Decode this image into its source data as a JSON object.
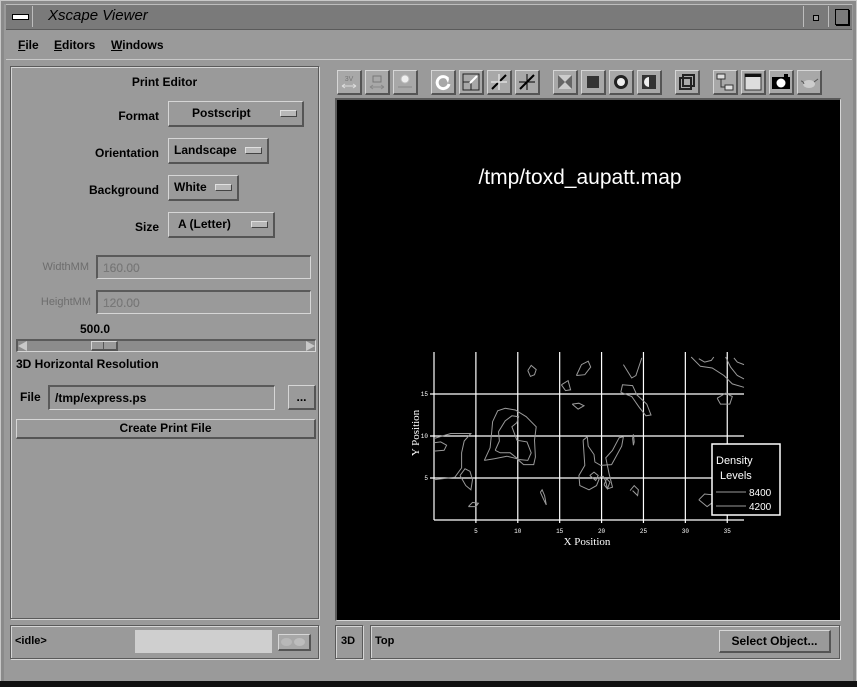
{
  "window": {
    "title": "Xscape Viewer",
    "menu_icon": "window-menu-icon",
    "minimize_icon": "minimize-icon",
    "maximize_icon": "maximize-icon"
  },
  "menubar": {
    "items": [
      {
        "label": "File",
        "mnemonic": "F",
        "rest": "ile"
      },
      {
        "label": "Editors",
        "mnemonic": "E",
        "rest": "ditors"
      },
      {
        "label": "Windows",
        "mnemonic": "W",
        "rest": "indows"
      }
    ]
  },
  "print_editor": {
    "title": "Print Editor",
    "format": {
      "label": "Format",
      "value": "Postscript"
    },
    "orientation": {
      "label": "Orientation",
      "value": "Landscape"
    },
    "background": {
      "label": "Background",
      "value": "White"
    },
    "size": {
      "label": "Size",
      "value": "A (Letter)"
    },
    "width": {
      "label": "WidthMM",
      "value": "160.00",
      "disabled": true
    },
    "height": {
      "label": "HeightMM",
      "value": "120.00",
      "disabled": true
    },
    "resolution": {
      "label": "3D Horizontal Resolution",
      "value": "500.0",
      "slider_fraction": 0.25
    },
    "file": {
      "label": "File",
      "value": "/tmp/express.ps",
      "browse_label": "..."
    },
    "create_button": "Create Print File"
  },
  "toolbar": {
    "groups": [
      [
        "stereo-icon",
        "camera-stereo-icon",
        "light-stereo-icon"
      ],
      [
        "rotate-icon",
        "zoom-box-icon",
        "expand-icon",
        "collapse-icon"
      ],
      [
        "transparent-icon",
        "solid-square-icon",
        "sphere-icon",
        "half-sphere-icon"
      ],
      [
        "wireframe-cube-icon"
      ],
      [
        "tree-hierarchy-icon",
        "window-icon",
        "snapshot-camera-icon",
        "teapot-icon"
      ]
    ]
  },
  "status": {
    "state": "<idle>",
    "mode": "3D",
    "view": "Top",
    "select_button": "Select Object..."
  },
  "chart_data": {
    "type": "contour",
    "title": "/tmp/toxd_aupatt.map",
    "xlabel": "X Position",
    "ylabel": "Y Position",
    "x_ticks": [
      "5",
      "10",
      "15",
      "20",
      "25",
      "30",
      "35"
    ],
    "y_ticks": [
      "5",
      "10",
      "15"
    ],
    "xlim": [
      0,
      37
    ],
    "ylim": [
      0,
      20
    ],
    "grid": true,
    "legend": {
      "title_line1": "Density",
      "title_line2": "Levels",
      "placement": "bottom-right",
      "entries": [
        {
          "label": "8400"
        },
        {
          "label": "4200"
        }
      ]
    },
    "levels": [
      4200,
      8400
    ],
    "colors": {
      "background": "#000000",
      "grid": "#ffffff",
      "contour": "#9a9a9a",
      "text": "#ffffff"
    },
    "contours": [
      {
        "level": 4200,
        "points": [
          [
            0,
            9.7
          ],
          [
            2,
            10.3
          ],
          [
            4.4,
            10.3
          ],
          [
            3.6,
            9.4
          ],
          [
            3.3,
            8
          ],
          [
            3.3,
            6.2
          ],
          [
            2.5,
            5.1
          ],
          [
            0,
            4.8
          ]
        ]
      },
      {
        "level": 4200,
        "points": [
          [
            0,
            8.2
          ],
          [
            1.2,
            8.3
          ],
          [
            1.5,
            8.9
          ],
          [
            0.8,
            9.3
          ],
          [
            0,
            9.2
          ]
        ]
      },
      {
        "level": 4200,
        "points": [
          [
            6,
            7.1
          ],
          [
            6.7,
            8.6
          ],
          [
            6.9,
            10.6
          ],
          [
            7,
            11.7
          ],
          [
            7.6,
            13
          ],
          [
            8.5,
            13.3
          ],
          [
            9.7,
            13.1
          ],
          [
            11,
            12.3
          ],
          [
            12.2,
            11.1
          ],
          [
            12,
            9.5
          ],
          [
            12.1,
            7.5
          ],
          [
            11.9,
            6.6
          ],
          [
            10.7,
            6.6
          ],
          [
            9.9,
            7.3
          ],
          [
            8.7,
            7.6
          ],
          [
            7.2,
            7.3
          ],
          [
            6,
            7.1
          ]
        ]
      },
      {
        "level": 8400,
        "points": [
          [
            7.3,
            8.3
          ],
          [
            7.8,
            9.4
          ],
          [
            7.7,
            10.5
          ],
          [
            8.5,
            11.8
          ],
          [
            9.3,
            12.4
          ],
          [
            10.1,
            12.3
          ],
          [
            9.9,
            11.6
          ],
          [
            9.3,
            11.1
          ],
          [
            9.9,
            9.5
          ],
          [
            11.1,
            9.3
          ],
          [
            11.6,
            8
          ],
          [
            11.2,
            7.1
          ],
          [
            10.1,
            7.2
          ],
          [
            9.1,
            8
          ],
          [
            7.9,
            8
          ],
          [
            7.3,
            8.3
          ]
        ]
      },
      {
        "level": 4200,
        "points": [
          [
            3.1,
            5.3
          ],
          [
            3.8,
            4.1
          ],
          [
            4.4,
            3.6
          ],
          [
            4.6,
            4.8
          ],
          [
            4.3,
            5.8
          ],
          [
            3.7,
            6.1
          ],
          [
            3.1,
            5.3
          ]
        ]
      },
      {
        "level": 4200,
        "points": [
          [
            4.1,
            1.6
          ],
          [
            4.6,
            2.1
          ],
          [
            5.3,
            2
          ],
          [
            5,
            1.6
          ],
          [
            4.1,
            1.6
          ]
        ]
      },
      {
        "level": 4200,
        "points": [
          [
            12.7,
            3.3
          ],
          [
            13.1,
            2.4
          ],
          [
            13.4,
            1.8
          ],
          [
            13.2,
            2.9
          ],
          [
            12.9,
            3.6
          ],
          [
            12.7,
            3.3
          ]
        ]
      },
      {
        "level": 4200,
        "points": [
          [
            11.2,
            17.8
          ],
          [
            11.5,
            17.1
          ],
          [
            12,
            17.3
          ],
          [
            12.2,
            17.9
          ],
          [
            11.6,
            18.4
          ],
          [
            11.2,
            17.8
          ]
        ]
      },
      {
        "level": 4200,
        "points": [
          [
            15.2,
            16.1
          ],
          [
            15.7,
            15.4
          ],
          [
            16.3,
            15.5
          ],
          [
            16,
            16.6
          ],
          [
            15.2,
            16.1
          ]
        ]
      },
      {
        "level": 4200,
        "points": [
          [
            17,
            17.2
          ],
          [
            17.6,
            18.5
          ],
          [
            18.4,
            18.9
          ],
          [
            18.7,
            18.2
          ],
          [
            18,
            17.3
          ],
          [
            17,
            17.2
          ]
        ]
      },
      {
        "level": 4200,
        "points": [
          [
            17.8,
            9.5
          ],
          [
            18.3,
            9.9
          ],
          [
            18.4,
            8.8
          ],
          [
            19.1,
            7.8
          ],
          [
            19.2,
            6.9
          ],
          [
            19.9,
            6.5
          ],
          [
            21.2,
            6.6
          ],
          [
            21.7,
            7.5
          ],
          [
            22.4,
            8.8
          ],
          [
            22.6,
            9.9
          ],
          [
            22.1,
            9.8
          ],
          [
            21.3,
            8.3
          ],
          [
            20.5,
            7.4
          ],
          [
            20.9,
            5.5
          ],
          [
            21.3,
            3.9
          ],
          [
            20.7,
            3.7
          ],
          [
            20.5,
            4.6
          ],
          [
            20.2,
            5.2
          ],
          [
            19.8,
            5.1
          ],
          [
            19.4,
            4.1
          ],
          [
            18.5,
            3.6
          ],
          [
            17.4,
            4.1
          ],
          [
            17.3,
            5.3
          ],
          [
            18,
            6.5
          ],
          [
            17.9,
            7.9
          ],
          [
            17.8,
            9.5
          ]
        ]
      },
      {
        "level": 8400,
        "points": [
          [
            18.6,
            5.3
          ],
          [
            19.1,
            5.7
          ],
          [
            19.6,
            5.3
          ],
          [
            19.3,
            4.7
          ],
          [
            18.6,
            5.3
          ]
        ]
      },
      {
        "level": 4200,
        "points": [
          [
            20.3,
            4.2
          ],
          [
            20.7,
            3.7
          ],
          [
            21,
            4.5
          ],
          [
            20.6,
            4.9
          ],
          [
            20.3,
            4.2
          ]
        ]
      },
      {
        "level": 4200,
        "points": [
          [
            23.7,
            9.7
          ],
          [
            23.8,
            10.2
          ],
          [
            23.9,
            9.3
          ],
          [
            23.8,
            8.9
          ],
          [
            23.7,
            9.7
          ]
        ]
      },
      {
        "level": 4200,
        "points": [
          [
            23.4,
            3.5
          ],
          [
            23.9,
            4.1
          ],
          [
            24.4,
            3.6
          ],
          [
            24.3,
            2.9
          ],
          [
            23.7,
            3.5
          ]
        ]
      },
      {
        "level": 4200,
        "points": [
          [
            22.3,
            15.2
          ],
          [
            22.5,
            16.1
          ],
          [
            23.7,
            16
          ],
          [
            24.2,
            14.9
          ],
          [
            25.4,
            13.8
          ],
          [
            25.9,
            12.5
          ],
          [
            25.3,
            12.4
          ],
          [
            24.5,
            13.4
          ],
          [
            23.6,
            14.7
          ],
          [
            22.3,
            15.2
          ]
        ]
      },
      {
        "level": 4200,
        "points": [
          [
            22.6,
            18.5
          ],
          [
            23.6,
            16.9
          ],
          [
            24.1,
            17.2
          ],
          [
            24.5,
            18.4
          ],
          [
            24.8,
            19.3
          ]
        ]
      },
      {
        "level": 4200,
        "points": [
          [
            16.5,
            13.8
          ],
          [
            17.3,
            13.9
          ],
          [
            17.9,
            13.6
          ],
          [
            17.2,
            13.2
          ],
          [
            16.5,
            13.8
          ]
        ]
      },
      {
        "level": 4200,
        "points": [
          [
            33.8,
            14.5
          ],
          [
            34.8,
            15.1
          ],
          [
            35.6,
            14.7
          ],
          [
            35.3,
            13.8
          ],
          [
            34.2,
            13.8
          ],
          [
            33.8,
            14.5
          ]
        ]
      },
      {
        "level": 4200,
        "points": [
          [
            31.6,
            2.4
          ],
          [
            32.3,
            3.1
          ],
          [
            33.2,
            3
          ],
          [
            33.4,
            2.2
          ],
          [
            32.6,
            1.6
          ],
          [
            31.6,
            2.4
          ]
        ]
      },
      {
        "level": 8400,
        "points": [
          [
            31.6,
            19.2
          ],
          [
            32.3,
            18.8
          ],
          [
            33.1,
            19
          ],
          [
            33.4,
            19.4
          ]
        ]
      },
      {
        "level": 4200,
        "points": [
          [
            30.7,
            19.4
          ],
          [
            31.8,
            18.3
          ],
          [
            33.2,
            18.1
          ],
          [
            34.6,
            17.2
          ],
          [
            35.6,
            16.2
          ],
          [
            37,
            15.8
          ]
        ]
      },
      {
        "level": 4200,
        "points": [
          [
            34.8,
            19.4
          ],
          [
            35.4,
            18.2
          ],
          [
            36.2,
            17.2
          ],
          [
            37,
            16.8
          ]
        ]
      },
      {
        "level": 8400,
        "points": [
          [
            35.8,
            19.3
          ],
          [
            36.2,
            18.8
          ],
          [
            37,
            18.5
          ]
        ]
      }
    ]
  }
}
